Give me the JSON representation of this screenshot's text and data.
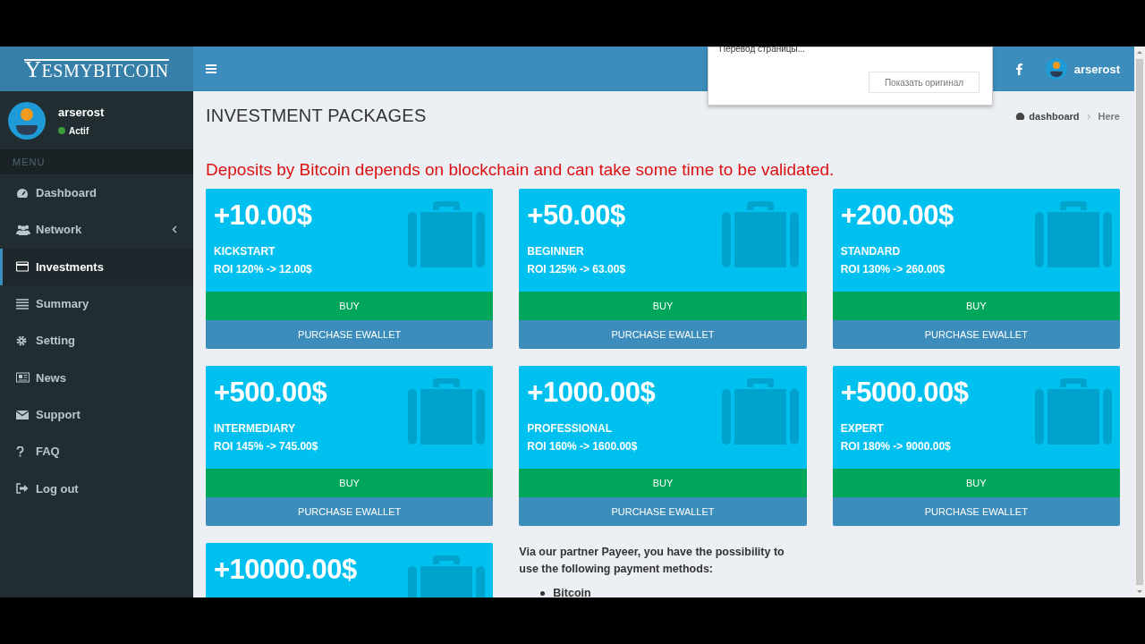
{
  "logo": "YESMYBITCOIN",
  "user": {
    "name": "arserost",
    "status": "Actif"
  },
  "menu_label": "MENU",
  "sidebar": {
    "items": [
      {
        "label": "Dashboard",
        "selected": false,
        "expandable": false
      },
      {
        "label": "Network",
        "selected": false,
        "expandable": true
      },
      {
        "label": "Investments",
        "selected": true,
        "expandable": false
      },
      {
        "label": "Summary",
        "selected": false,
        "expandable": false
      },
      {
        "label": "Setting",
        "selected": false,
        "expandable": false
      },
      {
        "label": "News",
        "selected": false,
        "expandable": false
      },
      {
        "label": "Support",
        "selected": false,
        "expandable": false
      },
      {
        "label": "FAQ",
        "selected": false,
        "expandable": false
      },
      {
        "label": "Log out",
        "selected": false,
        "expandable": false
      }
    ]
  },
  "header": {
    "user_name": "arserost"
  },
  "translate_popup": {
    "title": "Перевод страницы...",
    "button": "Показать оригинал"
  },
  "page": {
    "title": "INVESTMENT PACKAGES",
    "breadcrumb": [
      "dashboard",
      "Here"
    ],
    "notice": "Deposits by Bitcoin depends on blockchain and can take some time to be validated."
  },
  "packages": [
    {
      "amount": "+10.00$",
      "name": "KICKSTART",
      "roi": "ROI 120% -> 12.00$",
      "buy": "BUY",
      "ewallet": "PURCHASE EWALLET"
    },
    {
      "amount": "+50.00$",
      "name": "BEGINNER",
      "roi": "ROI 125% -> 63.00$",
      "buy": "BUY",
      "ewallet": "PURCHASE EWALLET"
    },
    {
      "amount": "+200.00$",
      "name": "STANDARD",
      "roi": "ROI 130% -> 260.00$",
      "buy": "BUY",
      "ewallet": "PURCHASE EWALLET"
    },
    {
      "amount": "+500.00$",
      "name": "INTERMEDIARY",
      "roi": "ROI 145% -> 745.00$",
      "buy": "BUY",
      "ewallet": "PURCHASE EWALLET"
    },
    {
      "amount": "+1000.00$",
      "name": "PROFESSIONAL",
      "roi": "ROI 160% -> 1600.00$",
      "buy": "BUY",
      "ewallet": "PURCHASE EWALLET"
    },
    {
      "amount": "+5000.00$",
      "name": "EXPERT",
      "roi": "ROI 180% -> 9000.00$",
      "buy": "BUY",
      "ewallet": "PURCHASE EWALLET"
    },
    {
      "amount": "+10000.00$"
    }
  ],
  "payment_info": {
    "text": "Via our partner Payeer, you have the possibility to use the following payment methods:",
    "methods": [
      "Bitcoin"
    ]
  }
}
